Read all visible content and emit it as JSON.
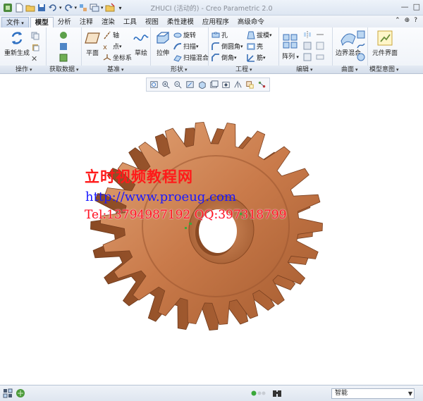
{
  "window": {
    "title": "ZHUCI (活动的) - Creo Parametric 2.0",
    "colors": {
      "ribbon_bg": "#eef2f8",
      "accent": "#3a6fb0",
      "gear_copper": "#c97a4a"
    }
  },
  "quick_access": [
    "new-icon",
    "open-icon",
    "save-icon",
    "undo-icon",
    "redo-icon",
    "regenerate-icon",
    "windows-icon",
    "close-window-icon",
    "customize-icon"
  ],
  "tabs": [
    "文件",
    "模型",
    "分析",
    "注释",
    "渲染",
    "工具",
    "视图",
    "柔性建模",
    "应用程序",
    "高级命令"
  ],
  "active_tab": "模型",
  "ribbon": {
    "operations": {
      "label": "操作",
      "regenerate": "重新生成"
    },
    "get_data": {
      "label": "获取数据"
    },
    "datum": {
      "label": "基准",
      "plane": "平面",
      "axis": "轴",
      "point": "点",
      "coord": "坐标系",
      "sketch": "草绘"
    },
    "shapes": {
      "label": "形状",
      "extrude": "拉伸",
      "revolve": "旋转",
      "sweep": "扫描",
      "swept_blend": "扫描混合"
    },
    "engineering": {
      "label": "工程",
      "hole": "孔",
      "round": "倒圆角",
      "chamfer": "倒角",
      "draft": "拔模",
      "shell": "壳",
      "rib": "筋"
    },
    "editing": {
      "label": "编辑",
      "pattern": "阵列"
    },
    "surfaces": {
      "label": "曲面",
      "boundary_blend": "边界混合"
    },
    "model_intent": {
      "label": "模型意图",
      "component_interface": "元件界面"
    }
  },
  "view_toolbar": [
    "refit-icon",
    "zoom-in-icon",
    "zoom-out-icon",
    "repaint-icon",
    "display-style-icon",
    "saved-views-icon",
    "view-manager-icon",
    "perspective-icon",
    "datum-display-icon",
    "annotation-display-icon"
  ],
  "watermark": {
    "line1": "立时视频教程网",
    "line2": "http://www.proeug.com",
    "line3": "Tel:13794987192  QQ:397318799"
  },
  "status": {
    "filter_value": "智能"
  }
}
